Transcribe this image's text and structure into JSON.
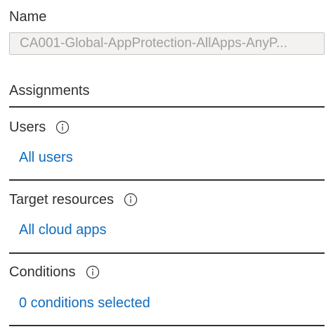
{
  "name": {
    "label": "Name",
    "value": "CA001-Global-AppProtection-AllApps-AnyP..."
  },
  "assignments": {
    "title": "Assignments",
    "rows": [
      {
        "label": "Users",
        "link": "All users"
      },
      {
        "label": "Target resources",
        "link": "All cloud apps"
      },
      {
        "label": "Conditions",
        "link": "0 conditions selected"
      }
    ]
  },
  "colors": {
    "link": "#0f6cbd",
    "text": "#323130",
    "field_bg": "#f3f2f1",
    "field_border": "#c8c6c4",
    "field_text": "#a19f9d"
  },
  "icons": {
    "info": "info-icon"
  }
}
